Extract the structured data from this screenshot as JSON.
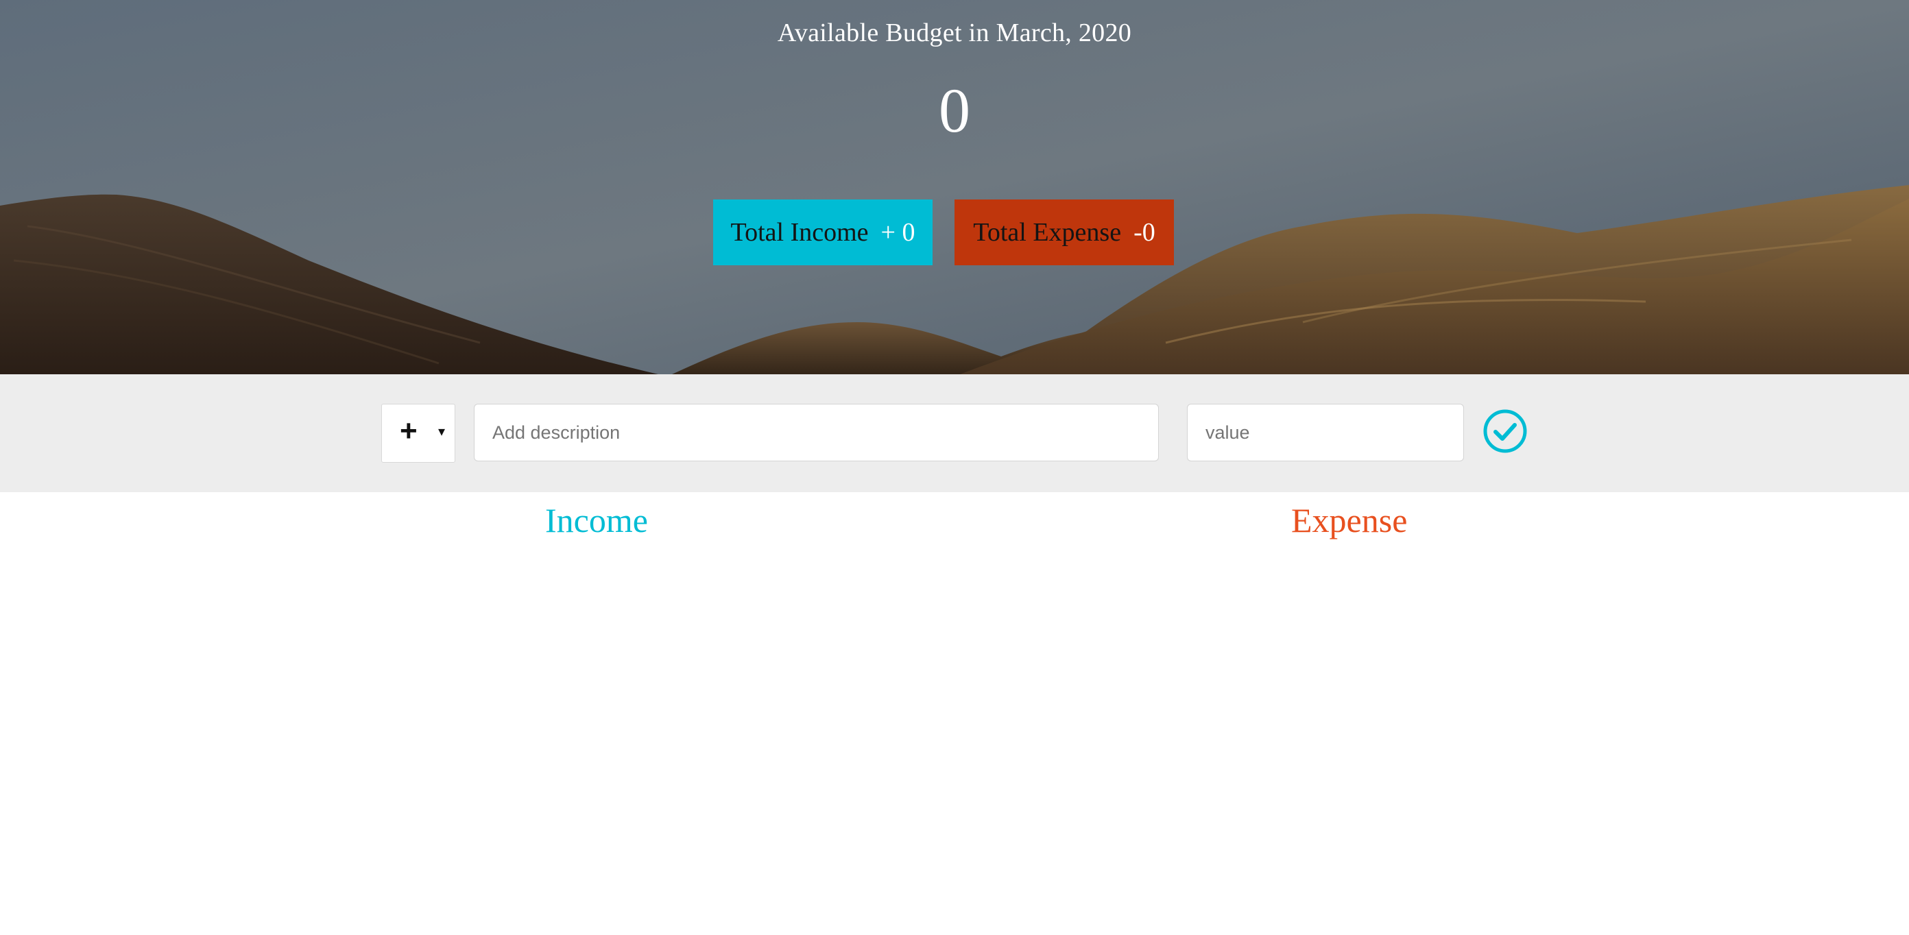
{
  "header": {
    "title": "Available Budget in March, 2020",
    "budget": "0"
  },
  "summary": {
    "income_label": "Total Income",
    "income_value": "+ 0",
    "expense_label": "Total Expense",
    "expense_value": "-0"
  },
  "form": {
    "type_symbol": "+",
    "caret": "▾",
    "description_placeholder": "Add description",
    "value_placeholder": "value",
    "submit_icon": "check-circle-icon"
  },
  "lists": {
    "income_title": "Income",
    "expense_title": "Expense"
  },
  "colors": {
    "income_accent": "#00bcd4",
    "expense_box": "#bf360c",
    "expense_title": "#e8501f",
    "input_bar_bg": "#ededed"
  }
}
